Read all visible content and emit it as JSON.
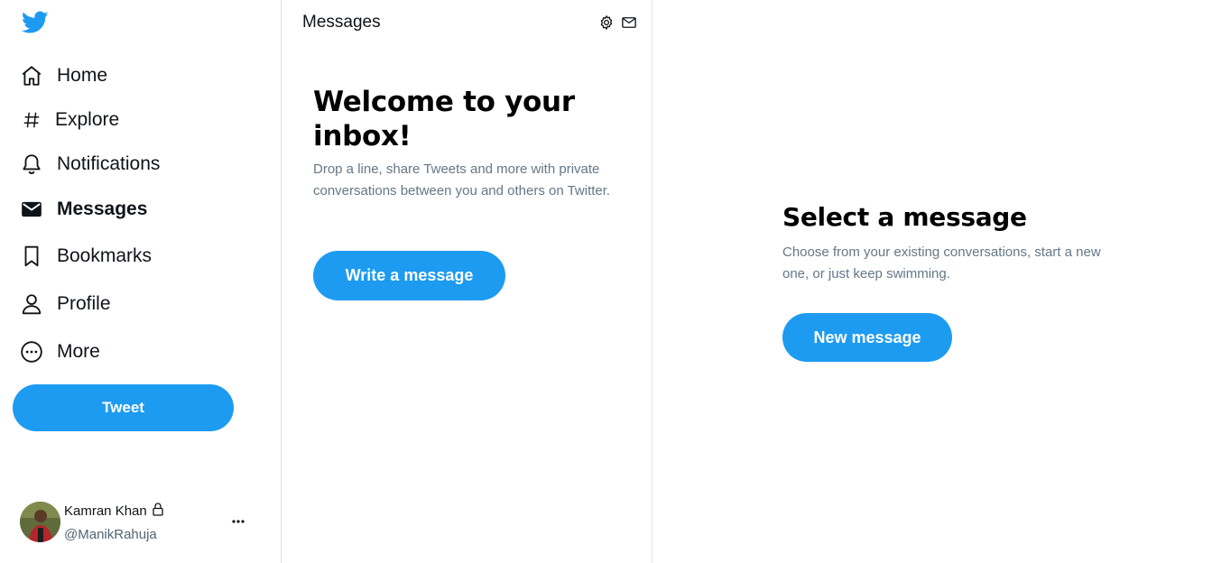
{
  "colors": {
    "accent": "#1d9bf0",
    "text": "#0f1419",
    "muted": "#657786",
    "border": "#dfe3e6"
  },
  "sidebar": {
    "logo": "twitter-bird-icon",
    "items": [
      {
        "label": "Home",
        "icon": "home-icon",
        "active": false
      },
      {
        "label": "Explore",
        "icon": "hashtag-icon",
        "active": false
      },
      {
        "label": "Notifications",
        "icon": "bell-icon",
        "active": false
      },
      {
        "label": "Messages",
        "icon": "envelope-icon",
        "active": true
      },
      {
        "label": "Bookmarks",
        "icon": "bookmark-icon",
        "active": false
      },
      {
        "label": "Profile",
        "icon": "person-icon",
        "active": false
      },
      {
        "label": "More",
        "icon": "more-circle-icon",
        "active": false
      }
    ],
    "tweet_label": "Tweet",
    "account": {
      "name": "Kamran Khan",
      "handle": "@ManikRahuja",
      "locked": true
    }
  },
  "messages_list": {
    "title": "Messages",
    "header_icons": [
      "settings-icon",
      "new-message-icon"
    ],
    "welcome_title": "Welcome to your inbox!",
    "welcome_text": "Drop a line, share Tweets and more with private conversations between you and others on Twitter.",
    "button_label": "Write a message"
  },
  "detail": {
    "title": "Select a message",
    "text": "Choose from your existing conversations, start a new one, or just keep swimming.",
    "button_label": "New message"
  }
}
